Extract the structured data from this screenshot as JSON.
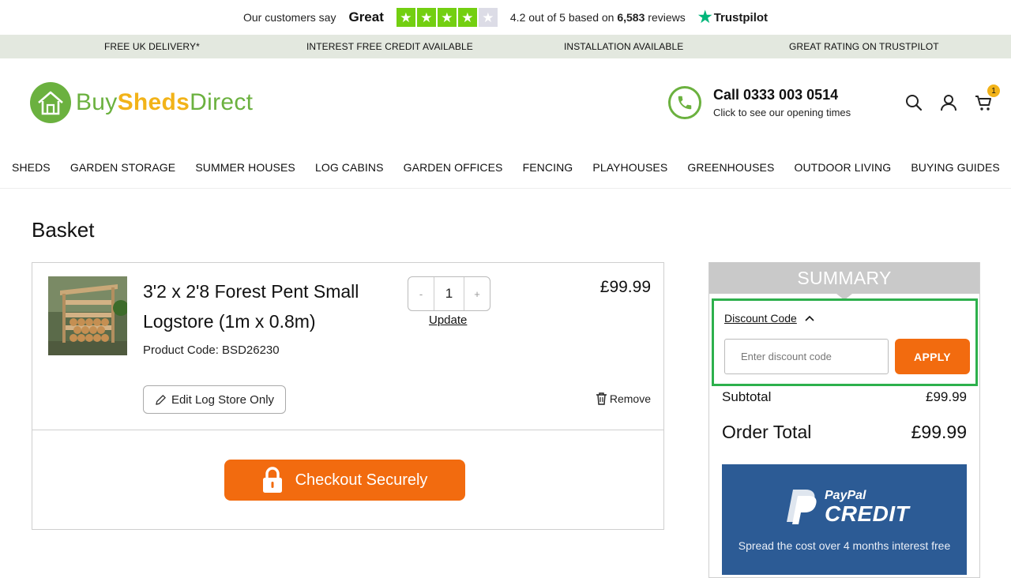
{
  "trustpilot": {
    "customers_say": "Our customers say",
    "rating_word": "Great",
    "score_text_a": "4.2 out of 5 based on ",
    "review_count": "6,583",
    "score_text_b": " reviews",
    "brand": "Trustpilot",
    "stars": 4.2,
    "star_color": "#73cf11"
  },
  "usp": [
    "FREE UK DELIVERY*",
    "INTEREST FREE CREDIT AVAILABLE",
    "INSTALLATION AVAILABLE",
    "GREAT RATING ON TRUSTPILOT"
  ],
  "header": {
    "logo": {
      "buy": "Buy",
      "sheds": "Sheds",
      "direct": "Direct"
    },
    "call_label": "Call 0333 003 0514",
    "call_sub": "Click to see our opening times",
    "cart_count": "1",
    "icons": [
      "search-icon",
      "account-icon",
      "cart-icon"
    ]
  },
  "nav": [
    "SHEDS",
    "GARDEN STORAGE",
    "SUMMER HOUSES",
    "LOG CABINS",
    "GARDEN OFFICES",
    "FENCING",
    "PLAYHOUSES",
    "GREENHOUSES",
    "OUTDOOR LIVING",
    "BUYING GUIDES"
  ],
  "basket": {
    "title": "Basket",
    "item": {
      "name": "3'2 x 2'8 Forest Pent Small Logstore (1m x 0.8m)",
      "code": "Product Code: BSD26230",
      "qty": "1",
      "qty_minus": "-",
      "qty_plus": "+",
      "update": "Update",
      "price": "£99.99",
      "edit": "Edit Log Store Only",
      "remove": "Remove"
    },
    "checkout": "Checkout Securely"
  },
  "summary": {
    "title": "SUMMARY",
    "discount_toggle": "Discount Code",
    "discount_placeholder": "Enter discount code",
    "apply": "APPLY",
    "subtotal_label": "Subtotal",
    "subtotal_value": "£99.99",
    "total_label": "Order Total",
    "total_value": "£99.99",
    "paypal_top": "PayPal",
    "paypal_credit": "CREDIT",
    "paypal_text": "Spread the cost over 4 months interest free"
  },
  "colors": {
    "brand_green": "#6bb13f",
    "brand_yellow": "#f2b319",
    "cta_orange": "#f26b0f",
    "highlight_green": "#2db04c",
    "paypal_blue": "#2c5b95"
  }
}
